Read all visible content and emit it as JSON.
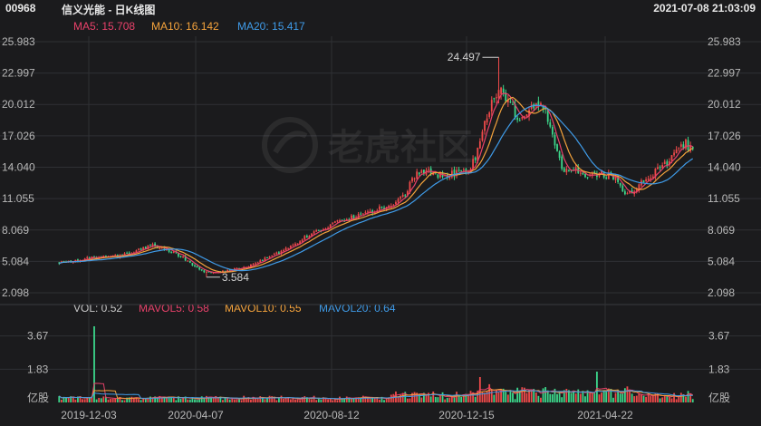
{
  "header": {
    "code": "00968",
    "name": "信义光能 - 日K线图",
    "datetime": "2021-07-08 21:03:09"
  },
  "ma_legend": [
    {
      "label": "MA5: 15.708",
      "color": "#e8416a"
    },
    {
      "label": "MA10: 16.142",
      "color": "#f5a33c"
    },
    {
      "label": "MA20: 15.417",
      "color": "#3f9be8"
    }
  ],
  "vol_legend": [
    {
      "label": "VOL: 0.52",
      "color": "#c8c8c8"
    },
    {
      "label": "MAVOL5: 0.58",
      "color": "#e8416a"
    },
    {
      "label": "MAVOL10: 0.55",
      "color": "#f5a33c"
    },
    {
      "label": "MAVOL20: 0.64",
      "color": "#3f9be8"
    }
  ],
  "watermark": {
    "text": "老虎社区"
  },
  "colors": {
    "up": "#ef4a4a",
    "down": "#3cd68a",
    "ma5": "#e8416a",
    "ma10": "#f5a33c",
    "ma20": "#3f9be8",
    "grid": "#2f3034",
    "axis_text": "#b8b8b8"
  },
  "chart_data": [
    {
      "type": "candlestick",
      "name": "price",
      "y_ticks": [
        "25.983",
        "22.997",
        "20.012",
        "17.026",
        "14.040",
        "11.055",
        "8.069",
        "5.084",
        "2.098"
      ],
      "ylim": [
        2.098,
        25.983
      ],
      "x_ticks": [
        "2019-12-03",
        "2020-04-07",
        "2020-08-12",
        "2020-12-15",
        "2021-04-22"
      ],
      "annotations": [
        {
          "label": "24.497",
          "kind": "high",
          "value": 24.497
        },
        {
          "label": "3.584",
          "kind": "low",
          "value": 3.584
        }
      ],
      "series_anchors": [
        {
          "x": 0,
          "close": 5.0
        },
        {
          "x": 8,
          "close": 5.2
        },
        {
          "x": 16,
          "close": 5.5
        },
        {
          "x": 26,
          "close": 5.6
        },
        {
          "x": 34,
          "close": 6.2
        },
        {
          "x": 40,
          "close": 6.6
        },
        {
          "x": 46,
          "close": 6.2
        },
        {
          "x": 52,
          "close": 5.6
        },
        {
          "x": 58,
          "close": 4.6
        },
        {
          "x": 62,
          "close": 4.1
        },
        {
          "x": 66,
          "close": 4.0
        },
        {
          "x": 72,
          "close": 4.2
        },
        {
          "x": 80,
          "close": 4.6
        },
        {
          "x": 88,
          "close": 5.3
        },
        {
          "x": 96,
          "close": 6.1
        },
        {
          "x": 104,
          "close": 7.2
        },
        {
          "x": 112,
          "close": 8.2
        },
        {
          "x": 120,
          "close": 8.9
        },
        {
          "x": 128,
          "close": 9.5
        },
        {
          "x": 136,
          "close": 10.0
        },
        {
          "x": 142,
          "close": 10.4
        },
        {
          "x": 148,
          "close": 11.5
        },
        {
          "x": 152,
          "close": 13.3
        },
        {
          "x": 156,
          "close": 13.8
        },
        {
          "x": 162,
          "close": 13.3
        },
        {
          "x": 168,
          "close": 13.4
        },
        {
          "x": 174,
          "close": 13.6
        },
        {
          "x": 178,
          "close": 14.8
        },
        {
          "x": 182,
          "close": 18.5
        },
        {
          "x": 186,
          "close": 20.5
        },
        {
          "x": 189,
          "close": 21.5
        },
        {
          "x": 192,
          "close": 20.3
        },
        {
          "x": 196,
          "close": 18.9
        },
        {
          "x": 200,
          "close": 19.0
        },
        {
          "x": 204,
          "close": 20.3
        },
        {
          "x": 208,
          "close": 19.2
        },
        {
          "x": 212,
          "close": 16.0
        },
        {
          "x": 216,
          "close": 13.6
        },
        {
          "x": 220,
          "close": 14.0
        },
        {
          "x": 226,
          "close": 13.3
        },
        {
          "x": 232,
          "close": 13.4
        },
        {
          "x": 238,
          "close": 13.0
        },
        {
          "x": 242,
          "close": 11.2
        },
        {
          "x": 246,
          "close": 11.8
        },
        {
          "x": 252,
          "close": 13.2
        },
        {
          "x": 258,
          "close": 14.0
        },
        {
          "x": 264,
          "close": 15.5
        },
        {
          "x": 268,
          "close": 16.3
        },
        {
          "x": 271,
          "close": 15.6
        }
      ]
    },
    {
      "type": "bar",
      "name": "volume",
      "y_ticks": [
        "3.67",
        "1.83",
        "亿股"
      ],
      "ylim": [
        0,
        4.6
      ],
      "x_ticks": [
        "2019-12-03",
        "2020-04-07",
        "2020-08-12",
        "2020-12-15",
        "2021-04-22"
      ]
    }
  ]
}
